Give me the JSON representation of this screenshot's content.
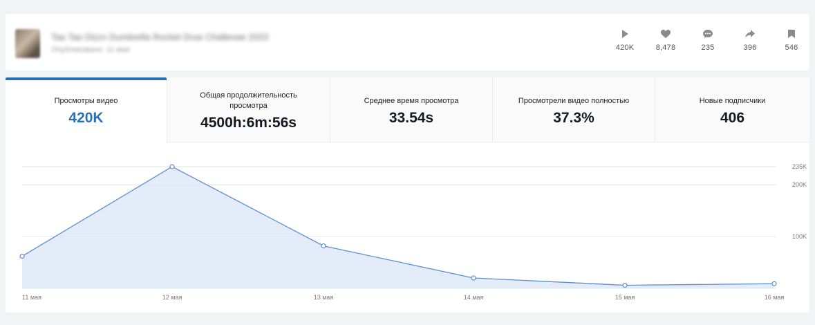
{
  "video": {
    "title": "Tap Tap Dizzy Dumbrella Rocket Drop Challenge 2023",
    "date": "Опубликовано: 11 мая"
  },
  "header_stats": [
    {
      "icon": "play-icon",
      "value": "420K"
    },
    {
      "icon": "heart-icon",
      "value": "8,478"
    },
    {
      "icon": "comment-icon",
      "value": "235"
    },
    {
      "icon": "share-icon",
      "value": "396"
    },
    {
      "icon": "bookmark-icon",
      "value": "546"
    }
  ],
  "metric_tabs": [
    {
      "label": "Просмотры видео",
      "value": "420K",
      "active": true
    },
    {
      "label": "Общая продолжительность просмотра",
      "value": "4500h:6m:56s",
      "active": false
    },
    {
      "label": "Среднее время просмотра",
      "value": "33.54s",
      "active": false
    },
    {
      "label": "Просмотрели видео полностью",
      "value": "37.3%",
      "active": false
    },
    {
      "label": "Новые подписчики",
      "value": "406",
      "active": false
    }
  ],
  "colors": {
    "accent": "#2b6fb5",
    "line": "#5b8fd0",
    "area": "#dfe9f8"
  },
  "chart_data": {
    "type": "area",
    "x": [
      "11 мая",
      "12 мая",
      "13 мая",
      "14 мая",
      "15 мая",
      "16 мая"
    ],
    "series": [
      {
        "values": [
          62000,
          235000,
          82000,
          20000,
          6000,
          9000
        ]
      }
    ],
    "ylim": [
      0,
      235000
    ],
    "y_ticks": [
      100000,
      200000,
      235000
    ],
    "y_tick_labels": [
      "100K",
      "200K",
      "235K"
    ],
    "grid": true,
    "title": "",
    "xlabel": "",
    "ylabel": ""
  }
}
